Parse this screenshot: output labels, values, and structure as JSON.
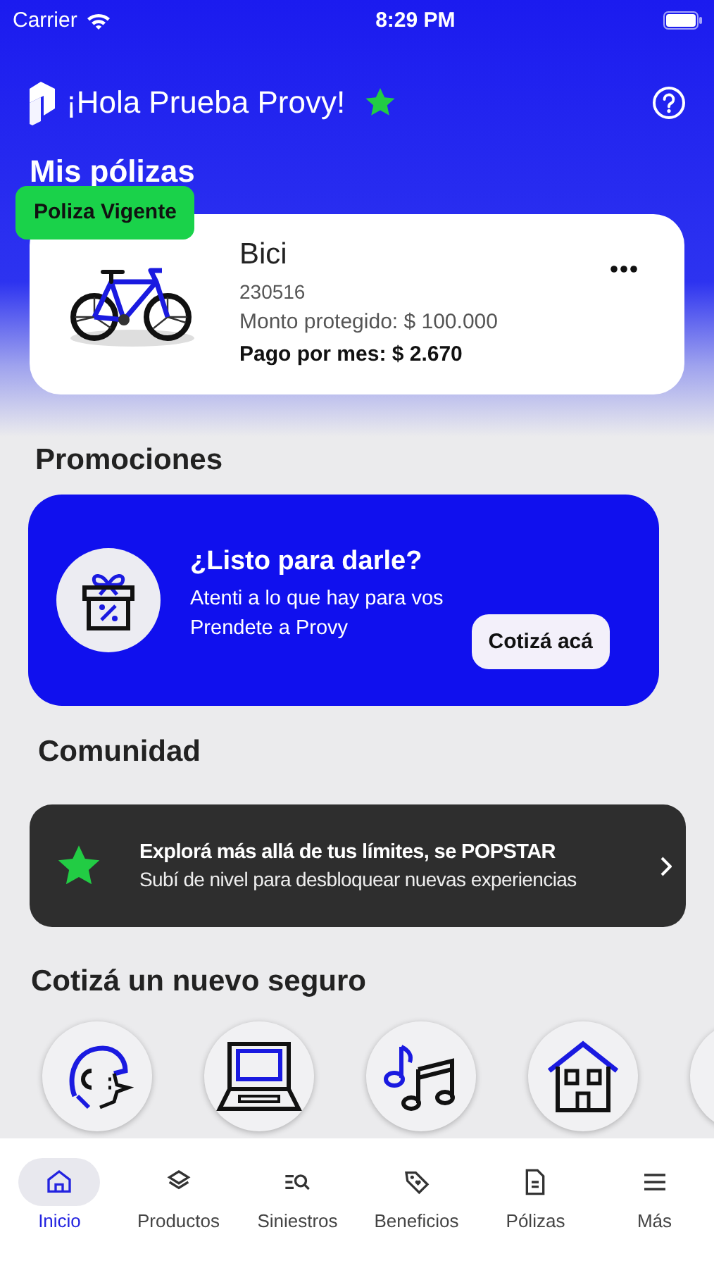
{
  "status_bar": {
    "carrier": "Carrier",
    "time": "8:29 PM"
  },
  "header": {
    "greeting": "¡Hola Prueba Provy!"
  },
  "policies_section": {
    "title": "Mis pólizas",
    "policies": [
      {
        "status": "Poliza Vigente",
        "name": "Bici",
        "number": "230516",
        "insured_amount": "Monto protegido: $ 100.000",
        "monthly_payment": "Pago por mes: $ 2.670"
      }
    ]
  },
  "promotions": {
    "title": "Promociones",
    "card": {
      "title": "¿Listo para darle?",
      "text": "Atenti a lo que hay para vos",
      "subtext": "Prendete a Provy",
      "button": "Cotizá acá"
    }
  },
  "community": {
    "title": "Comunidad",
    "card": {
      "title": "Explorá más allá de tus límites, se POPSTAR",
      "subtitle": "Subí de nivel para desbloquear nuevas experiencias"
    }
  },
  "new_insurance": {
    "title": "Cotizá un nuevo seguro",
    "options": [
      {
        "kind": "helmet"
      },
      {
        "kind": "laptop"
      },
      {
        "kind": "music"
      },
      {
        "kind": "house"
      },
      {
        "kind": "other"
      }
    ]
  },
  "bottom_nav": [
    {
      "label": "Inicio",
      "kind": "home",
      "selected": true
    },
    {
      "label": "Productos",
      "kind": "layers",
      "selected": false
    },
    {
      "label": "Siniestros",
      "kind": "search-list",
      "selected": false
    },
    {
      "label": "Beneficios",
      "kind": "tag",
      "selected": false
    },
    {
      "label": "Pólizas",
      "kind": "document",
      "selected": false
    },
    {
      "label": "Más",
      "kind": "menu",
      "selected": false
    }
  ]
}
